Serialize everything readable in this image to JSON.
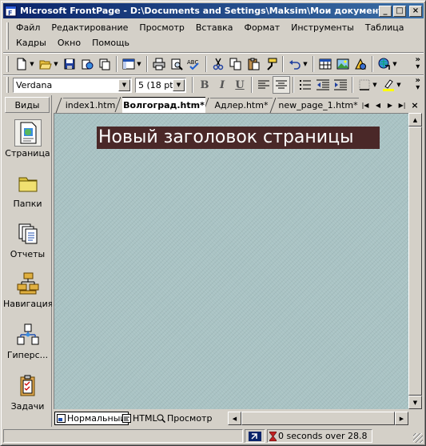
{
  "window": {
    "title": "Microsoft FrontPage - D:\\Documents and Settings\\Maksim\\Мои документы\\...",
    "controls": {
      "minimize": "_",
      "maximize": "□",
      "close": "×"
    }
  },
  "menu": {
    "row1": [
      "Файл",
      "Редактирование",
      "Просмотр",
      "Вставка",
      "Формат",
      "Инструменты",
      "Таблица"
    ],
    "row2": [
      "Кадры",
      "Окно",
      "Помощь"
    ]
  },
  "formatting": {
    "font": "Verdana",
    "size": "5 (18 pt)",
    "bold": "B",
    "italic": "I",
    "underline": "U"
  },
  "views": {
    "header": "Виды",
    "items": [
      {
        "label": "Страница",
        "icon": "page-view-icon",
        "active": true
      },
      {
        "label": "Папки",
        "icon": "folder-icon",
        "active": false
      },
      {
        "label": "Отчеты",
        "icon": "reports-icon",
        "active": false
      },
      {
        "label": "Навигация",
        "icon": "navigation-icon",
        "active": false
      },
      {
        "label": "Гиперс...",
        "icon": "hyperlinks-icon",
        "active": false
      },
      {
        "label": "Задачи",
        "icon": "tasks-icon",
        "active": false
      }
    ]
  },
  "tabs": [
    {
      "label": "index1.htm",
      "active": false
    },
    {
      "label": "Волгоград.htm*",
      "active": true
    },
    {
      "label": "Адлер.htm*",
      "active": false
    },
    {
      "label": "new_page_1.htm*",
      "active": false
    }
  ],
  "editor": {
    "heading": "Новый заголовок страницы",
    "heading_bg": "#4a2828",
    "background": "#a9c3c4"
  },
  "view_tabs": {
    "normal": "Нормальный",
    "html": "HTML",
    "preview": "Просмотр"
  },
  "status": {
    "download_time": "0 seconds over 28.8"
  },
  "colors": {
    "titlebar_start": "#0a246a",
    "titlebar_end": "#3a6ea5",
    "chrome": "#d4d0c8"
  }
}
